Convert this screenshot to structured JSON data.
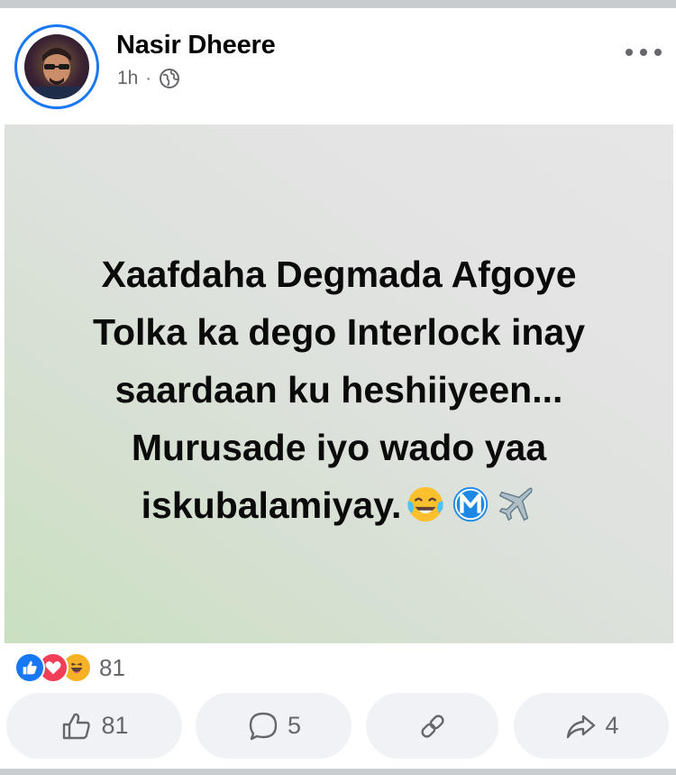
{
  "post": {
    "author": "Nasir Dheere",
    "time": "1h",
    "separator": "·",
    "audience_icon": "globe-icon",
    "more_icon": "more-options-icon",
    "text_lines": [
      "Xaafdaha Degmada Afgoye",
      "Tolka ka dego Interlock inay",
      "saardaan ku heshiiyeen...",
      "Murusade iyo wado yaa",
      "iskubalamiyay."
    ],
    "text_emojis": [
      "face-with-tears-of-joy-emoji",
      "circled-m-emoji",
      "airplane-emoji"
    ],
    "background_colors": [
      "#c9e0c0",
      "#e6e6e6"
    ]
  },
  "reactions": {
    "types": [
      "like",
      "love",
      "haha"
    ],
    "count": "81"
  },
  "actions": {
    "like_count": "81",
    "comment_count": "5",
    "share_count": "4"
  },
  "colors": {
    "accent": "#1877f2",
    "secondary_text": "#65676b",
    "button_bg": "#f0f2f5"
  }
}
